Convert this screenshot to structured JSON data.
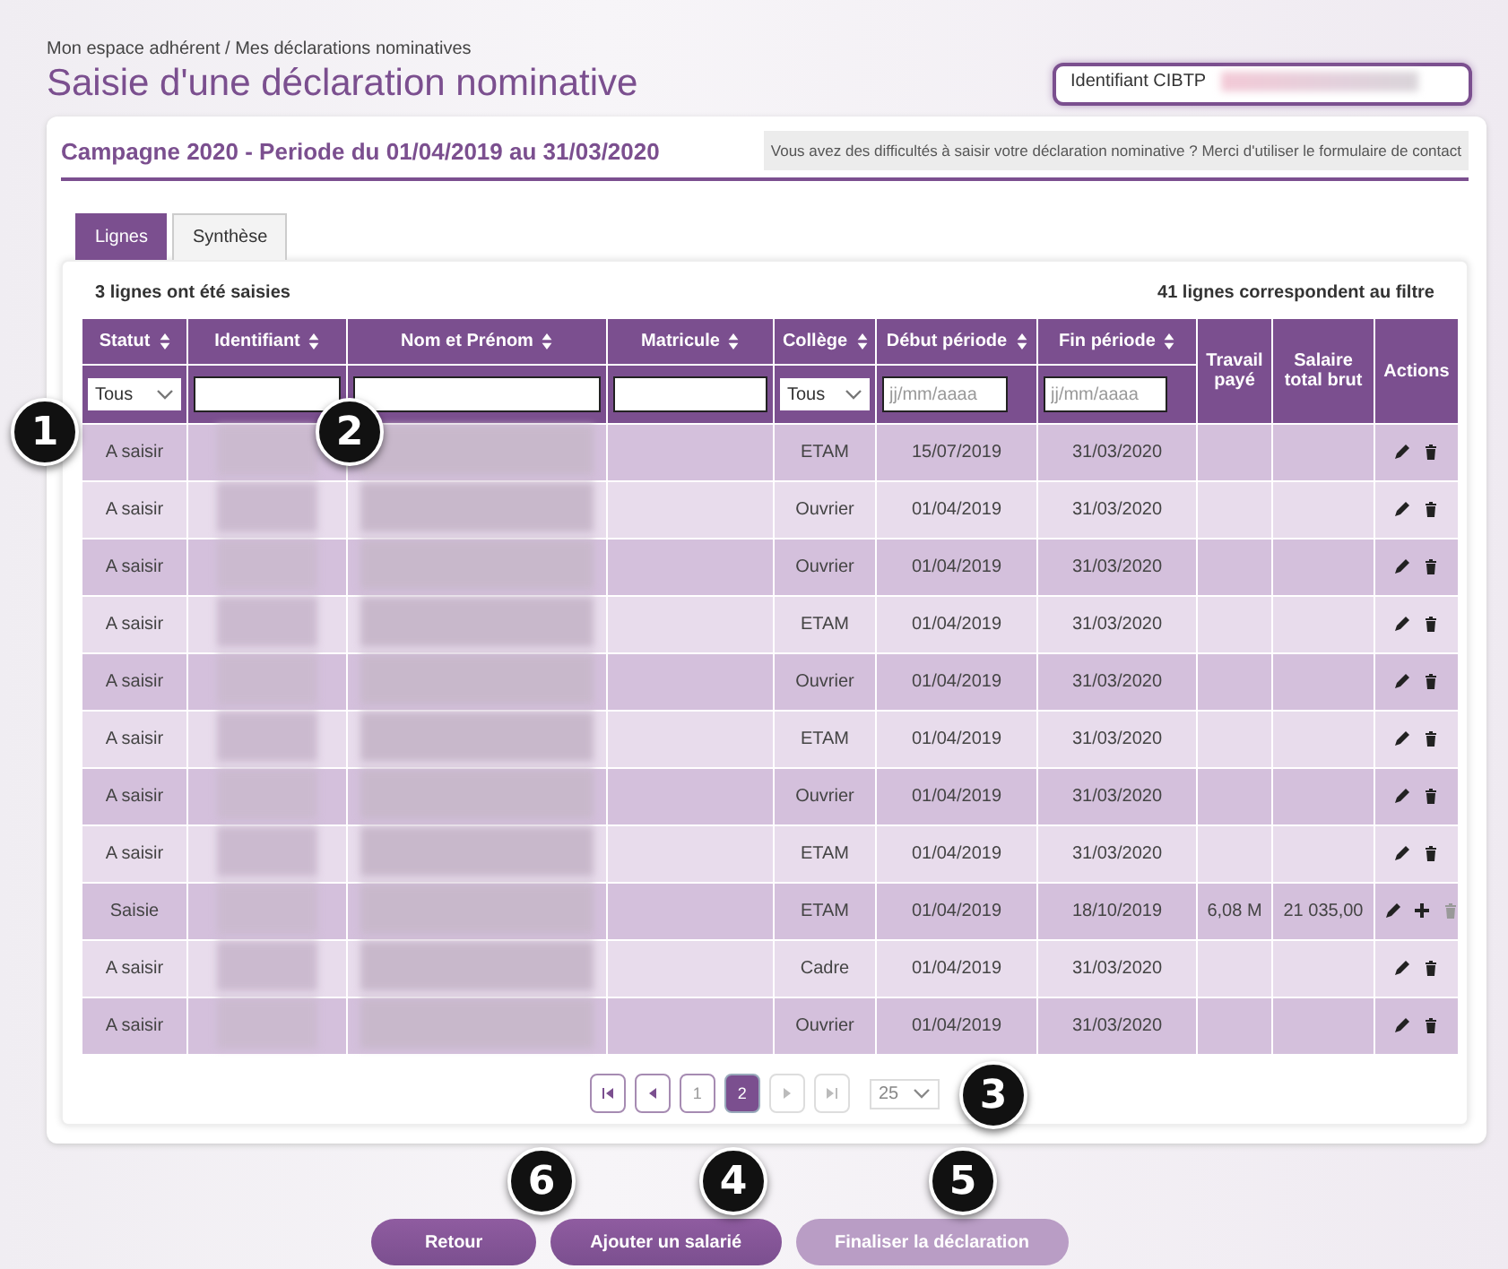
{
  "breadcrumb": "Mon espace adhérent / Mes déclarations nominatives",
  "title": "Saisie d'une déclaration nominative",
  "identifier_box": {
    "label": "Identifiant CIBTP"
  },
  "campaign": "Campagne 2020 - Periode du 01/04/2019 au 31/03/2020",
  "help_text": "Vous avez des difficultés à saisir votre déclaration nominative ? Merci d'utiliser le formulaire de contact",
  "tabs": [
    {
      "label": "Lignes",
      "selected": true
    },
    {
      "label": "Synthèse",
      "selected": false
    }
  ],
  "summary_left": "3 lignes ont été saisies",
  "summary_right": "41 lignes correspondent au filtre",
  "columns": [
    {
      "label": "Statut",
      "sortable": true,
      "filter": {
        "kind": "select",
        "value": "Tous"
      }
    },
    {
      "label": "Identifiant",
      "sortable": true,
      "filter": {
        "kind": "text"
      }
    },
    {
      "label": "Nom et Prénom",
      "sortable": true,
      "filter": {
        "kind": "text"
      }
    },
    {
      "label": "Matricule",
      "sortable": true,
      "filter": {
        "kind": "text"
      }
    },
    {
      "label": "Collège",
      "sortable": true,
      "filter": {
        "kind": "select",
        "value": "Tous"
      }
    },
    {
      "label": "Début période",
      "sortable": true,
      "filter": {
        "kind": "date",
        "placeholder": "jj/mm/aaaa"
      }
    },
    {
      "label": "Fin période",
      "sortable": true,
      "filter": {
        "kind": "date",
        "placeholder": "jj/mm/aaaa"
      }
    },
    {
      "label": "Travail payé",
      "sortable": false
    },
    {
      "label": "Salaire total brut",
      "sortable": false
    },
    {
      "label": "Actions",
      "sortable": false
    }
  ],
  "rows": [
    {
      "statut": "A saisir",
      "college": "ETAM",
      "debut": "15/07/2019",
      "fin": "31/03/2020",
      "can_add": false,
      "delete_disabled": false
    },
    {
      "statut": "A saisir",
      "college": "Ouvrier",
      "debut": "01/04/2019",
      "fin": "31/03/2020",
      "can_add": false,
      "delete_disabled": false
    },
    {
      "statut": "A saisir",
      "college": "Ouvrier",
      "debut": "01/04/2019",
      "fin": "31/03/2020",
      "can_add": false,
      "delete_disabled": false
    },
    {
      "statut": "A saisir",
      "college": "ETAM",
      "debut": "01/04/2019",
      "fin": "31/03/2020",
      "can_add": false,
      "delete_disabled": false
    },
    {
      "statut": "A saisir",
      "college": "Ouvrier",
      "debut": "01/04/2019",
      "fin": "31/03/2020",
      "can_add": false,
      "delete_disabled": false
    },
    {
      "statut": "A saisir",
      "college": "ETAM",
      "debut": "01/04/2019",
      "fin": "31/03/2020",
      "can_add": false,
      "delete_disabled": false
    },
    {
      "statut": "A saisir",
      "college": "Ouvrier",
      "debut": "01/04/2019",
      "fin": "31/03/2020",
      "can_add": false,
      "delete_disabled": false
    },
    {
      "statut": "A saisir",
      "college": "ETAM",
      "debut": "01/04/2019",
      "fin": "31/03/2020",
      "can_add": false,
      "delete_disabled": false
    },
    {
      "statut": "Saisie",
      "college": "ETAM",
      "debut": "01/04/2019",
      "fin": "18/10/2019",
      "travail": "6,08 M",
      "salaire": "21 035,00",
      "can_add": true,
      "delete_disabled": true
    },
    {
      "statut": "A saisir",
      "college": "Cadre",
      "debut": "01/04/2019",
      "fin": "31/03/2020",
      "can_add": false,
      "delete_disabled": false
    },
    {
      "statut": "A saisir",
      "college": "Ouvrier",
      "debut": "01/04/2019",
      "fin": "31/03/2020",
      "can_add": false,
      "delete_disabled": false
    }
  ],
  "pagination": {
    "pages": [
      {
        "label": "1",
        "selected": false
      },
      {
        "label": "2",
        "selected": true
      }
    ],
    "page_size": "25"
  },
  "buttons": [
    {
      "label": "Retour",
      "disabled": false
    },
    {
      "label": "Ajouter un salarié",
      "disabled": false
    },
    {
      "label": "Finaliser la déclaration",
      "disabled": true
    }
  ],
  "callouts": [
    "1",
    "2",
    "3",
    "6",
    "4",
    "5"
  ]
}
